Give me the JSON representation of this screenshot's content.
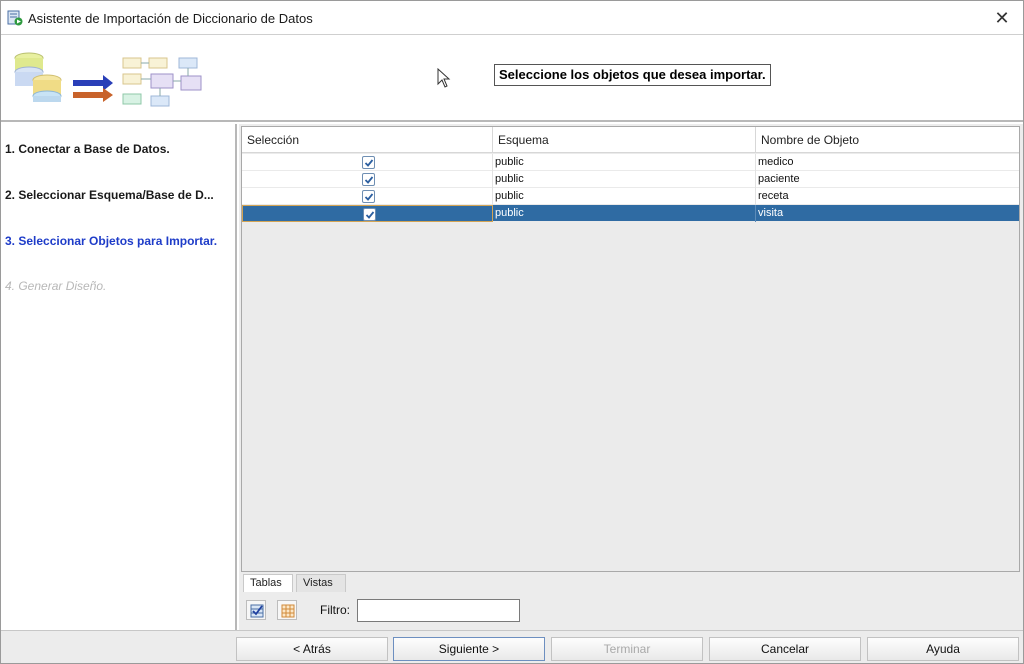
{
  "window": {
    "title": "Asistente de Importación de Diccionario de Datos",
    "close_glyph": "✕"
  },
  "banner": {
    "instruction": "Seleccione los objetos que desea importar."
  },
  "steps": [
    {
      "label": "1. Conectar a Base de Datos.",
      "state": "done"
    },
    {
      "label": "2. Seleccionar Esquema/Base de D...",
      "state": "done"
    },
    {
      "label": "3. Seleccionar Objetos para Importar.",
      "state": "current"
    },
    {
      "label": "4. Generar Diseño.",
      "state": "future"
    }
  ],
  "table": {
    "columns": [
      "Selección",
      "Esquema",
      "Nombre de Objeto"
    ],
    "rows": [
      {
        "checked": true,
        "schema": "public",
        "object": "medico",
        "selected": false
      },
      {
        "checked": true,
        "schema": "public",
        "object": "paciente",
        "selected": false
      },
      {
        "checked": true,
        "schema": "public",
        "object": "receta",
        "selected": false
      },
      {
        "checked": true,
        "schema": "public",
        "object": "visita",
        "selected": true
      }
    ]
  },
  "tabs": [
    {
      "label": "Tablas",
      "active": true
    },
    {
      "label": "Vistas",
      "active": false
    }
  ],
  "filter": {
    "label": "Filtro:",
    "value": ""
  },
  "footer": {
    "back": "< Atrás",
    "next": "Siguiente >",
    "finish": "Terminar",
    "cancel": "Cancelar",
    "help": "Ayuda"
  },
  "colors": {
    "current_step": "#1e3cc8",
    "selected_row": "#2f6ba3",
    "future_step": "#b7b7b7"
  },
  "icons": [
    "app-wizard-icon",
    "close-icon",
    "cursor-icon",
    "select-all-icon",
    "deselect-all-icon"
  ]
}
